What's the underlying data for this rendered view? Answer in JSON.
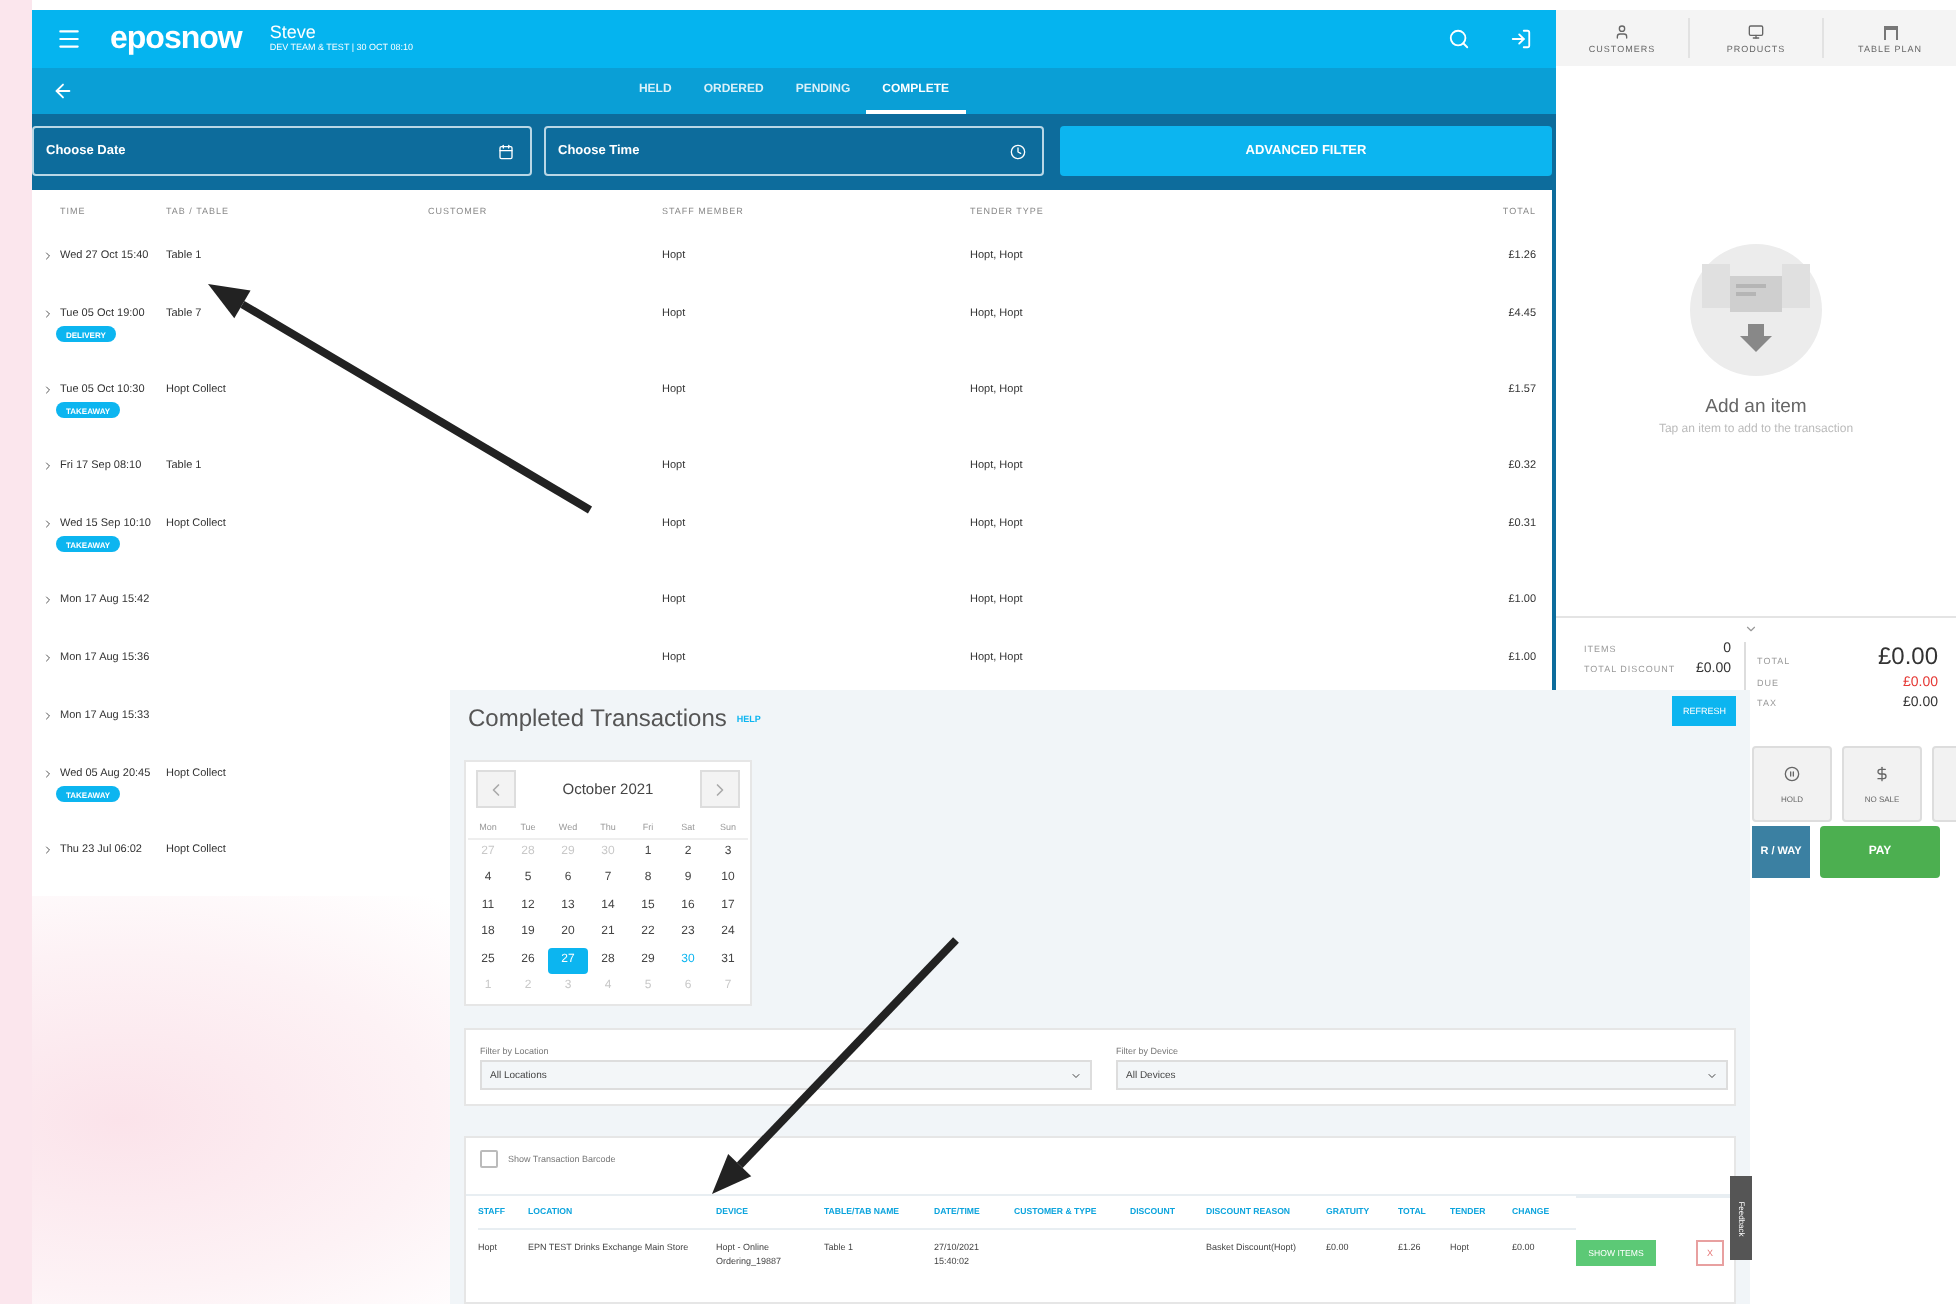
{
  "header": {
    "logo": "eposnow",
    "user": "Steve",
    "subtitle": "DEV TEAM & TEST | 30 OCT 08:10"
  },
  "tabs": [
    {
      "label": "HELD",
      "selected": false
    },
    {
      "label": "ORDERED",
      "selected": false
    },
    {
      "label": "PENDING",
      "selected": false
    },
    {
      "label": "COMPLETE",
      "selected": true
    }
  ],
  "filters": {
    "date_placeholder": "Choose Date",
    "time_placeholder": "Choose Time",
    "advanced_button": "ADVANCED FILTER"
  },
  "orders": {
    "columns": [
      "TIME",
      "TAB / TABLE",
      "CUSTOMER",
      "STAFF MEMBER",
      "TENDER TYPE",
      "TOTAL"
    ],
    "rows": [
      {
        "time": "Wed 27 Oct 15:40",
        "table": "Table 1",
        "staff": "Hopt",
        "tender": "Hopt, Hopt",
        "total": "£1.26"
      },
      {
        "time": "Tue 05 Oct 19:00",
        "table": "Table 7",
        "staff": "Hopt",
        "tender": "Hopt, Hopt",
        "total": "£4.45",
        "tag": "DELIVERY"
      },
      {
        "time": "Tue 05 Oct 10:30",
        "table": "Hopt Collect",
        "staff": "Hopt",
        "tender": "Hopt, Hopt",
        "total": "£1.57",
        "tag": "TAKEAWAY"
      },
      {
        "time": "Fri 17 Sep 08:10",
        "table": "Table 1",
        "staff": "Hopt",
        "tender": "Hopt, Hopt",
        "total": "£0.32"
      },
      {
        "time": "Wed 15 Sep 10:10",
        "table": "Hopt Collect",
        "staff": "Hopt",
        "tender": "Hopt, Hopt",
        "total": "£0.31",
        "tag": "TAKEAWAY"
      },
      {
        "time": "Mon 17 Aug 15:42",
        "staff": "Hopt",
        "tender": "Hopt, Hopt",
        "total": "£1.00"
      },
      {
        "time": "Mon 17 Aug 15:36",
        "staff": "Hopt",
        "tender": "Hopt, Hopt",
        "total": "£1.00"
      },
      {
        "time": "Mon 17 Aug 15:33"
      },
      {
        "time": "Wed 05 Aug 20:45",
        "table": "Hopt Collect",
        "tag": "TAKEAWAY"
      },
      {
        "time": "Thu 23 Jul 06:02",
        "table": "Hopt Collect"
      }
    ]
  },
  "side_nav": [
    "CUSTOMERS",
    "PRODUCTS",
    "TABLE PLAN"
  ],
  "basket": {
    "title": "Add an item",
    "hint": "Tap an item to add to the transaction"
  },
  "totals": {
    "items_label": "ITEMS",
    "items": "0",
    "discount_label": "TOTAL DISCOUNT",
    "discount": "£0.00",
    "total_label": "TOTAL",
    "total": "£0.00",
    "due_label": "DUE",
    "due": "£0.00",
    "tax_label": "TAX",
    "tax": "£0.00"
  },
  "actions": [
    "HOLD",
    "NO SALE"
  ],
  "order_button": "R / WAY",
  "pay_button": "PAY",
  "completed": {
    "title": "Completed Transactions",
    "help": "HELP",
    "refresh": "REFRESH",
    "calendar": {
      "month": "October 2021",
      "weekdays": [
        "Mon",
        "Tue",
        "Wed",
        "Thu",
        "Fri",
        "Sat",
        "Sun"
      ],
      "days": [
        {
          "label": "27",
          "kind": "muted"
        },
        {
          "label": "28",
          "kind": "muted"
        },
        {
          "label": "29",
          "kind": "muted"
        },
        {
          "label": "30",
          "kind": "muted"
        },
        {
          "label": "1",
          "kind": "day"
        },
        {
          "label": "2",
          "kind": "day"
        },
        {
          "label": "3",
          "kind": "day"
        },
        {
          "label": "4",
          "kind": "day"
        },
        {
          "label": "5",
          "kind": "day"
        },
        {
          "label": "6",
          "kind": "day"
        },
        {
          "label": "7",
          "kind": "day"
        },
        {
          "label": "8",
          "kind": "day"
        },
        {
          "label": "9",
          "kind": "day"
        },
        {
          "label": "10",
          "kind": "day"
        },
        {
          "label": "11",
          "kind": "day"
        },
        {
          "label": "12",
          "kind": "day"
        },
        {
          "label": "13",
          "kind": "day"
        },
        {
          "label": "14",
          "kind": "day"
        },
        {
          "label": "15",
          "kind": "day"
        },
        {
          "label": "16",
          "kind": "day"
        },
        {
          "label": "17",
          "kind": "day"
        },
        {
          "label": "18",
          "kind": "day"
        },
        {
          "label": "19",
          "kind": "day"
        },
        {
          "label": "20",
          "kind": "day"
        },
        {
          "label": "21",
          "kind": "day"
        },
        {
          "label": "22",
          "kind": "day"
        },
        {
          "label": "23",
          "kind": "day"
        },
        {
          "label": "24",
          "kind": "day"
        },
        {
          "label": "25",
          "kind": "day"
        },
        {
          "label": "26",
          "kind": "day"
        },
        {
          "label": "27",
          "kind": "selected"
        },
        {
          "label": "28",
          "kind": "day"
        },
        {
          "label": "29",
          "kind": "day"
        },
        {
          "label": "30",
          "kind": "today"
        },
        {
          "label": "31",
          "kind": "day"
        },
        {
          "label": "1",
          "kind": "muted"
        },
        {
          "label": "2",
          "kind": "muted"
        },
        {
          "label": "3",
          "kind": "muted"
        },
        {
          "label": "4",
          "kind": "muted"
        },
        {
          "label": "5",
          "kind": "muted"
        },
        {
          "label": "6",
          "kind": "muted"
        },
        {
          "label": "7",
          "kind": "muted"
        }
      ]
    },
    "location_label": "Filter by Location",
    "location": "All Locations",
    "device_label": "Filter by Device",
    "device": "All Devices",
    "barcode": {
      "label": "Show Transaction Barcode",
      "checked": false
    },
    "columns": [
      "STAFF",
      "LOCATION",
      "DEVICE",
      "TABLE/TAB NAME",
      "DATE/TIME",
      "CUSTOMER & TYPE",
      "DISCOUNT",
      "DISCOUNT REASON",
      "GRATUITY",
      "TOTAL",
      "TENDER",
      "CHANGE"
    ],
    "row": {
      "staff": "Hopt",
      "location": "EPN TEST Drinks Exchange Main Store",
      "device": "Hopt - Online Ordering_19887",
      "table": "Table 1",
      "datetime": "27/10/2021 15:40:02",
      "discount_reason": "Basket Discount(Hopt)",
      "gratuity": "£0.00",
      "total": "£1.26",
      "tender": "Hopt",
      "change": "£0.00",
      "show_items": "SHOW ITEMS",
      "remove": "X"
    },
    "feedback": "Feedback"
  }
}
